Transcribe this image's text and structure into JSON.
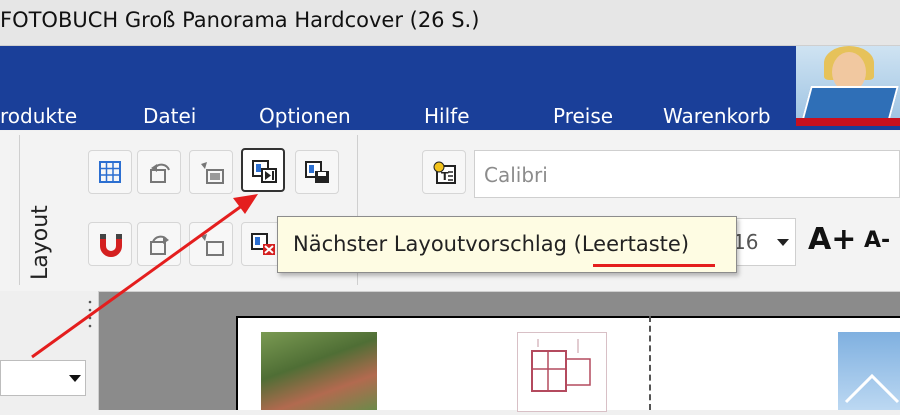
{
  "window": {
    "title": "FOTOBUCH Groß Panorama Hardcover  (26 S.)"
  },
  "menu": {
    "items": [
      "rodukte",
      "Datei",
      "Optionen",
      "Hilfe",
      "Preise",
      "Warenkorb"
    ]
  },
  "toolbar": {
    "group_label": "Layout",
    "buttons_row1": [
      "grid-layout-icon",
      "undo-layout-icon",
      "previous-layout-icon",
      "next-layout-icon",
      "save-layout-icon"
    ],
    "buttons_row2": [
      "magnet-icon",
      "redo-layout-icon",
      "swap-layout-icon",
      "delete-layout-icon"
    ],
    "font_placeholder": "Calibri",
    "font_size": "16",
    "grow_font_label": "A+",
    "shrink_font_label": "A-"
  },
  "tooltip": {
    "text": "Nächster Layoutvorschlag (Leertaste)"
  },
  "colors": {
    "menu_bar": "#1a3f99",
    "tooltip_bg": "#fefce3",
    "annotation": "#e41e1e",
    "magnet_red": "#d42020",
    "grid_blue": "#2c6fd1"
  }
}
